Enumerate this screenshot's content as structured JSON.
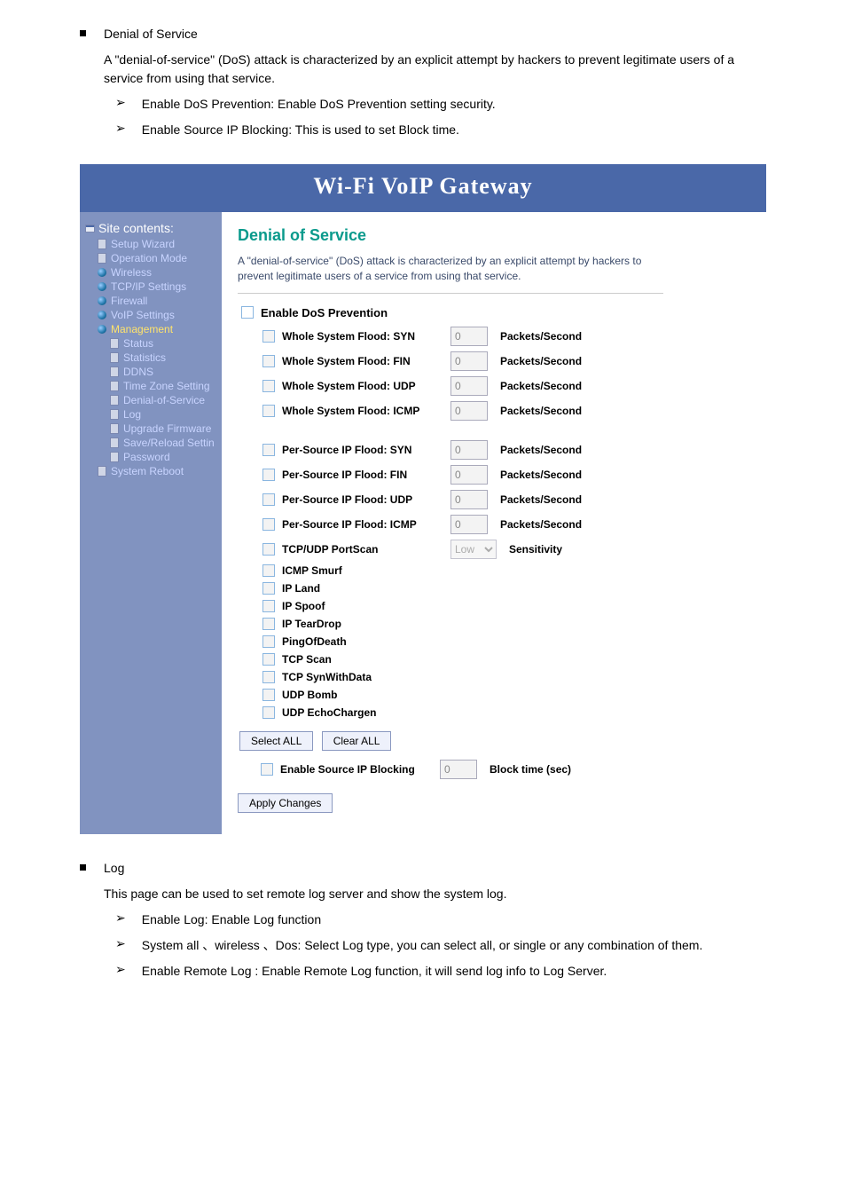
{
  "doc_top": {
    "bullet": "Denial of Service",
    "bullet_text": "A \"denial-of-service\" (DoS) attack is characterized by an explicit attempt by hackers to prevent legitimate users of a service from using that service.",
    "arrow1": "Enable DoS Prevention: Enable DoS Prevention setting security.",
    "arrow2": "Enable Source IP Blocking: This is used to set Block time."
  },
  "titlebar": "Wi-Fi  VoIP  Gateway",
  "sidebar": {
    "title": "Site contents:",
    "items": [
      {
        "label": "Setup Wizard",
        "icon": "file"
      },
      {
        "label": "Operation Mode",
        "icon": "file"
      },
      {
        "label": "Wireless",
        "icon": "globe"
      },
      {
        "label": "TCP/IP Settings",
        "icon": "globe"
      },
      {
        "label": "Firewall",
        "icon": "globe"
      },
      {
        "label": "VoIP Settings",
        "icon": "globe"
      },
      {
        "label": "Management",
        "icon": "globe",
        "active": true
      }
    ],
    "subitems": [
      {
        "label": "Status",
        "icon": "file"
      },
      {
        "label": "Statistics",
        "icon": "file"
      },
      {
        "label": "DDNS",
        "icon": "file"
      },
      {
        "label": "Time Zone Setting",
        "icon": "file"
      },
      {
        "label": "Denial-of-Service",
        "icon": "file"
      },
      {
        "label": "Log",
        "icon": "file"
      },
      {
        "label": "Upgrade Firmware",
        "icon": "file"
      },
      {
        "label": "Save/Reload Settin",
        "icon": "file"
      },
      {
        "label": "Password",
        "icon": "file"
      }
    ],
    "reboot": {
      "label": "System Reboot",
      "icon": "file"
    }
  },
  "page": {
    "title": "Denial of Service",
    "desc": "A \"denial-of-service\" (DoS) attack is characterized by an explicit attempt by hackers to prevent legitimate users of a service from using that service.",
    "enable_label": "Enable DoS Prevention",
    "unit": "Packets/Second",
    "sensitivity": "Sensitivity",
    "rows_num": [
      {
        "label": "Whole System Flood: SYN",
        "val": "0"
      },
      {
        "label": "Whole System Flood: FIN",
        "val": "0"
      },
      {
        "label": "Whole System Flood: UDP",
        "val": "0"
      },
      {
        "label": "Whole System Flood: ICMP",
        "val": "0"
      },
      {
        "label": "Per-Source IP Flood: SYN",
        "val": "0"
      },
      {
        "label": "Per-Source IP Flood: FIN",
        "val": "0"
      },
      {
        "label": "Per-Source IP Flood: UDP",
        "val": "0"
      },
      {
        "label": "Per-Source IP Flood: ICMP",
        "val": "0"
      }
    ],
    "portscan": {
      "label": "TCP/UDP PortScan",
      "options": [
        "Low"
      ],
      "selected": "Low"
    },
    "rows_simple": [
      "ICMP Smurf",
      "IP Land",
      "IP Spoof",
      "IP TearDrop",
      "PingOfDeath",
      "TCP Scan",
      "TCP SynWithData",
      "UDP Bomb",
      "UDP EchoChargen"
    ],
    "select_all": "Select ALL",
    "clear_all": "Clear ALL",
    "src_block": {
      "label": "Enable Source IP Blocking",
      "val": "0",
      "unit": "Block time (sec)"
    },
    "apply": "Apply Changes"
  },
  "doc_bottom": {
    "bullet": "Log",
    "bullet_text": "This page can be used to set remote log server and show the system log.",
    "arrow1": "Enable Log: Enable Log function",
    "arrow2": "System all 、wireless 、Dos: Select Log type, you can select all, or single or any combination of them.",
    "arrow3": "Enable Remote Log : Enable Remote Log function, it will send log info to Log Server."
  }
}
